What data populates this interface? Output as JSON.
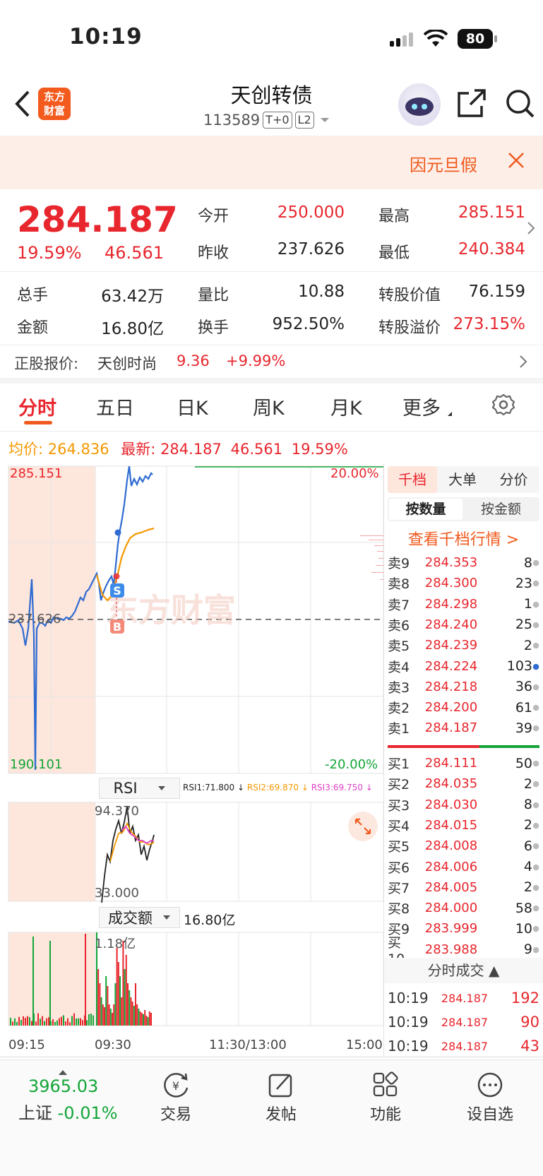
{
  "status_bar": {
    "time": "10:19",
    "battery": "80"
  },
  "nav": {
    "title": "天创转债",
    "code": "113589",
    "tag1": "T+0",
    "tag2": "L2",
    "logo_line1": "东方",
    "logo_line2": "财富"
  },
  "notice": {
    "text": "因元旦假"
  },
  "quote": {
    "price": "284.187",
    "change_pct": "19.59%",
    "change": "46.561",
    "open_label": "今开",
    "open": "250.000",
    "high_label": "最高",
    "high": "285.151",
    "prev_close_label": "昨收",
    "prev_close": "237.626",
    "low_label": "最低",
    "low": "240.384",
    "volume_label": "总手",
    "volume": "63.42万",
    "volume_ratio_label": "量比",
    "volume_ratio": "10.88",
    "conv_value_label": "转股价值",
    "conv_value": "76.159",
    "amount_label": "金额",
    "amount": "16.80亿",
    "turnover_label": "换手",
    "turnover": "952.50%",
    "conv_premium_label": "转股溢价",
    "conv_premium": "273.15%"
  },
  "stock": {
    "label": "正股报价:",
    "name": "天创时尚",
    "price": "9.36",
    "change": "+9.99%"
  },
  "tabs": [
    "分时",
    "五日",
    "日K",
    "周K",
    "月K",
    "更多"
  ],
  "chart": {
    "avg_label": "均价:",
    "avg_value": "264.836",
    "latest_label": "最新:",
    "latest_price": "284.187",
    "latest_change": "46.561",
    "latest_pct": "19.59%",
    "y_top": "285.151",
    "y_mid": "237.626",
    "y_bottom": "190.101",
    "pct_top": "20.00%",
    "pct_bottom": "-20.00%",
    "watermark": "东方财富",
    "rsi_selector": "RSI",
    "rsi1": "RSI1:71.800 ↓",
    "rsi2": "RSI2:69.870 ↓",
    "rsi3": "RSI3:69.750 ↓",
    "rsi_top": "94.370",
    "rsi_bottom": "33.000",
    "vol_selector": "成交额",
    "vol_total": "16.80亿",
    "vol_max": "1.18亿",
    "time_labels": [
      "09:15",
      "09:30",
      "11:30/13:00",
      "15:00"
    ],
    "colors": {
      "price": "#2f6bd1",
      "avg": "#f39800",
      "up": "#e8262d",
      "down": "#13a538",
      "preopen": "#fde6dc"
    }
  },
  "side": {
    "tabs": [
      "千档",
      "大单",
      "分价"
    ],
    "subtabs": [
      "按数量",
      "按金额"
    ],
    "link": "查看千档行情 >",
    "asks": [
      {
        "label": "卖9",
        "price": "284.353",
        "vol": "8"
      },
      {
        "label": "卖8",
        "price": "284.300",
        "vol": "23"
      },
      {
        "label": "卖7",
        "price": "284.298",
        "vol": "1"
      },
      {
        "label": "卖6",
        "price": "284.240",
        "vol": "25"
      },
      {
        "label": "卖5",
        "price": "284.239",
        "vol": "2"
      },
      {
        "label": "卖4",
        "price": "284.224",
        "vol": "103"
      },
      {
        "label": "卖3",
        "price": "284.218",
        "vol": "36"
      },
      {
        "label": "卖2",
        "price": "284.200",
        "vol": "61"
      },
      {
        "label": "卖1",
        "price": "284.187",
        "vol": "39"
      }
    ],
    "bids": [
      {
        "label": "买1",
        "price": "284.111",
        "vol": "50"
      },
      {
        "label": "买2",
        "price": "284.035",
        "vol": "2"
      },
      {
        "label": "买3",
        "price": "284.030",
        "vol": "8"
      },
      {
        "label": "买4",
        "price": "284.015",
        "vol": "2"
      },
      {
        "label": "买5",
        "price": "284.008",
        "vol": "6"
      },
      {
        "label": "买6",
        "price": "284.006",
        "vol": "4"
      },
      {
        "label": "买7",
        "price": "284.005",
        "vol": "2"
      },
      {
        "label": "买8",
        "price": "284.000",
        "vol": "58"
      },
      {
        "label": "买9",
        "price": "283.999",
        "vol": "10"
      },
      {
        "label": "买10",
        "price": "283.988",
        "vol": "9"
      }
    ],
    "trades_title": "分时成交 ▲",
    "trades": [
      {
        "time": "10:19",
        "price": "284.187",
        "vol": "192"
      },
      {
        "time": "10:19",
        "price": "284.187",
        "vol": "90"
      },
      {
        "time": "10:19",
        "price": "284.187",
        "vol": "43"
      }
    ]
  },
  "bottom": {
    "index_value": "3965.03",
    "index_name": "上证",
    "index_change": "-0.01%",
    "items": [
      "交易",
      "发帖",
      "功能",
      "设自选"
    ]
  }
}
